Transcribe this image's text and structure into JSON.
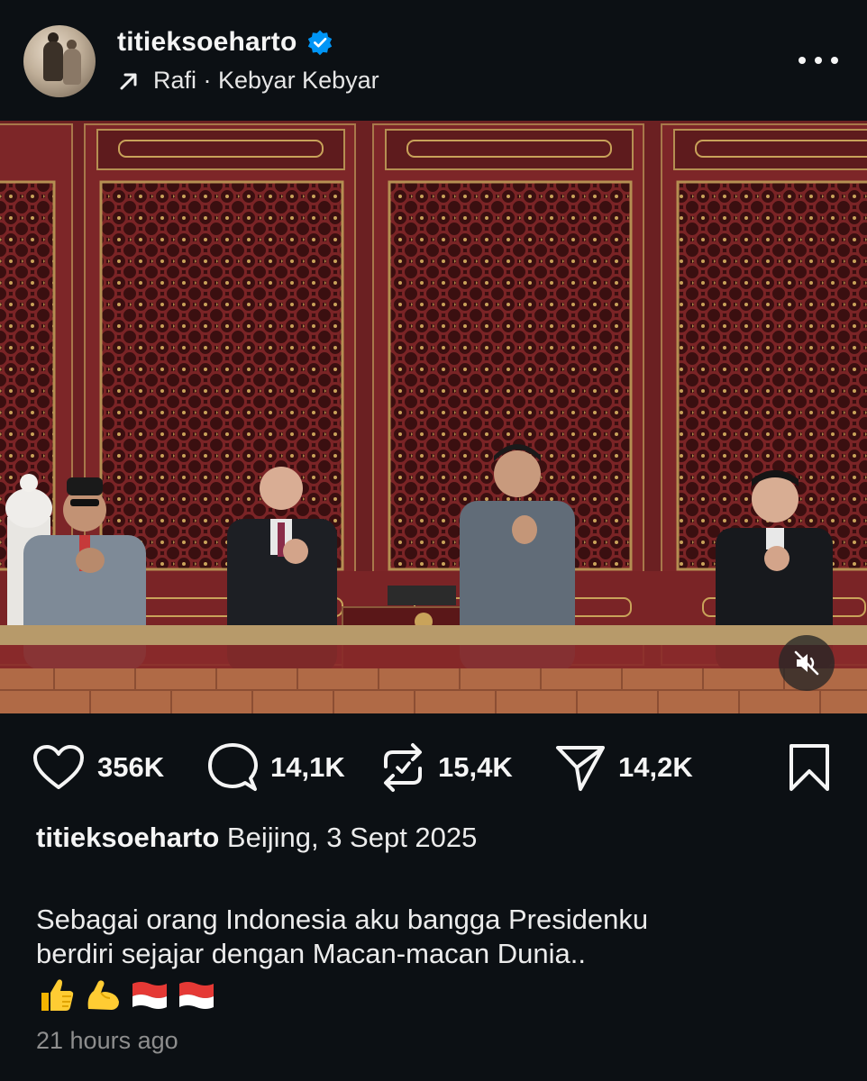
{
  "post": {
    "username": "titieksoeharto",
    "verified": true,
    "music": {
      "icon": "arrow-up-right-icon",
      "text": "Rafi · Kebyar Kebyar"
    }
  },
  "actions": {
    "likes": "356K",
    "comments": "14,1K",
    "reposts": "15,4K",
    "shares": "14,2K"
  },
  "caption": {
    "username": "titieksoeharto",
    "location_date": "Beijing, 3 Sept 2025",
    "line1": "Sebagai orang Indonesia aku bangga Presidenku",
    "line2": "berdiri sejajar dengan Macan-macan Dunia..",
    "emojis": [
      "thumbs-up",
      "flexed-biceps",
      "indonesia-flag",
      "indonesia-flag"
    ]
  },
  "timestamp": "21 hours ago",
  "colors": {
    "background": "#0c1014",
    "verified_blue": "#0095f6",
    "muted_text": "#8e8e8e"
  }
}
